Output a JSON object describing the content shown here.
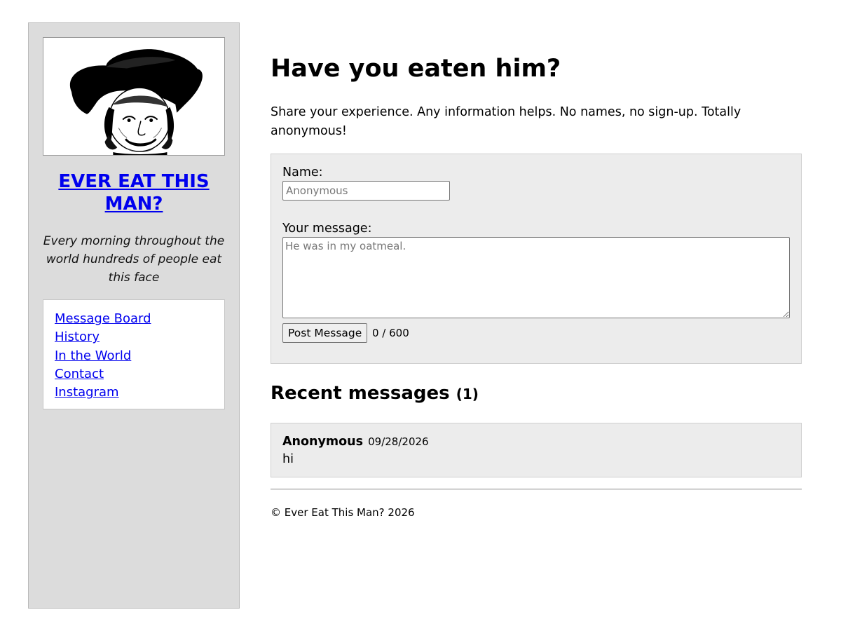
{
  "sidebar": {
    "portrait_alt": "Quaker man portrait",
    "site_title": "EVER EAT THIS MAN?",
    "tagline": "Every morning throughout the world hundreds of people eat this face",
    "nav": [
      {
        "label": "Message Board"
      },
      {
        "label": "History"
      },
      {
        "label": "In the World"
      },
      {
        "label": "Contact"
      },
      {
        "label": "Instagram"
      }
    ]
  },
  "main": {
    "title": "Have you eaten him?",
    "intro": "Share your experience. Any information helps. No names, no sign-up. Totally anonymous!",
    "form": {
      "name_label": "Name:",
      "name_placeholder": "Anonymous",
      "name_value": "",
      "message_label": "Your message:",
      "message_placeholder": "He was in my oatmeal.",
      "message_value": "",
      "submit_label": "Post Message",
      "char_count": "0 / 600"
    },
    "recent": {
      "heading": "Recent messages",
      "count": "(1)",
      "messages": [
        {
          "author": "Anonymous",
          "date": "09/28/2026",
          "text": "hi"
        }
      ]
    },
    "footer": "© Ever Eat This Man? 2026"
  },
  "colors": {
    "sidebar_bg": "#dcdcdc",
    "panel_bg": "#ececec",
    "link": "#0000ee"
  }
}
